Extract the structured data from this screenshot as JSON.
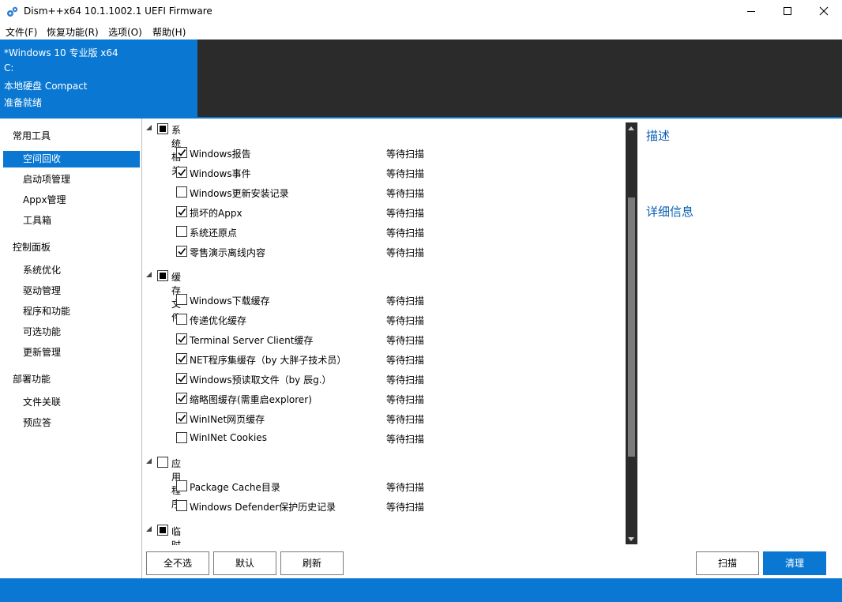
{
  "window": {
    "title": "Dism++x64 10.1.1002.1 UEFI Firmware"
  },
  "menu": [
    "文件(F)",
    "恢复功能(R)",
    "选项(O)",
    "帮助(H)"
  ],
  "header": {
    "os": "*Windows 10 专业版 x64",
    "drive": "C:",
    "disk": "本地硬盘 Compact",
    "status": "准备就绪"
  },
  "sidebar": {
    "groups": [
      {
        "label": "常用工具",
        "items": [
          "空间回收",
          "启动项管理",
          "Appx管理",
          "工具箱"
        ]
      },
      {
        "label": "控制面板",
        "items": [
          "系统优化",
          "驱动管理",
          "程序和功能",
          "可选功能",
          "更新管理"
        ]
      },
      {
        "label": "部署功能",
        "items": [
          "文件关联",
          "预应答"
        ]
      }
    ],
    "active": "空间回收"
  },
  "list": {
    "status_text": "等待扫描",
    "groups": [
      {
        "label": "系统相关",
        "state": "indeterminate",
        "items": [
          {
            "label": "Windows报告",
            "checked": true
          },
          {
            "label": "Windows事件",
            "checked": true
          },
          {
            "label": "Windows更新安装记录",
            "checked": false
          },
          {
            "label": "损坏的Appx",
            "checked": true
          },
          {
            "label": "系统还原点",
            "checked": false
          },
          {
            "label": "零售演示离线内容",
            "checked": true
          }
        ]
      },
      {
        "label": "缓存文件",
        "state": "indeterminate",
        "items": [
          {
            "label": "Windows下载缓存",
            "checked": false
          },
          {
            "label": "传递优化缓存",
            "checked": false
          },
          {
            "label": "Terminal Server Client缓存",
            "checked": true
          },
          {
            "label": "NET程序集缓存（by 大胖子技术员）",
            "checked": true
          },
          {
            "label": "Windows预读取文件（by 辰g.）",
            "checked": true
          },
          {
            "label": "缩略图缓存(需重启explorer)",
            "checked": true
          },
          {
            "label": "WinINet网页缓存",
            "checked": true
          },
          {
            "label": "WinINet Cookies",
            "checked": false
          }
        ]
      },
      {
        "label": "应用程序",
        "state": "unchecked",
        "items": [
          {
            "label": "Package Cache目录",
            "checked": false
          },
          {
            "label": "Windows Defender保护历史记录",
            "checked": false
          }
        ]
      },
      {
        "label": "临时文件",
        "state": "indeterminate",
        "items": []
      }
    ]
  },
  "right_panel": {
    "description_title": "描述",
    "details_title": "详细信息"
  },
  "buttons": {
    "deselect_all": "全不选",
    "default": "默认",
    "refresh": "刷新",
    "scan": "扫描",
    "clean": "清理"
  },
  "colors": {
    "accent": "#0a78d2",
    "dark": "#2b2b2b"
  }
}
